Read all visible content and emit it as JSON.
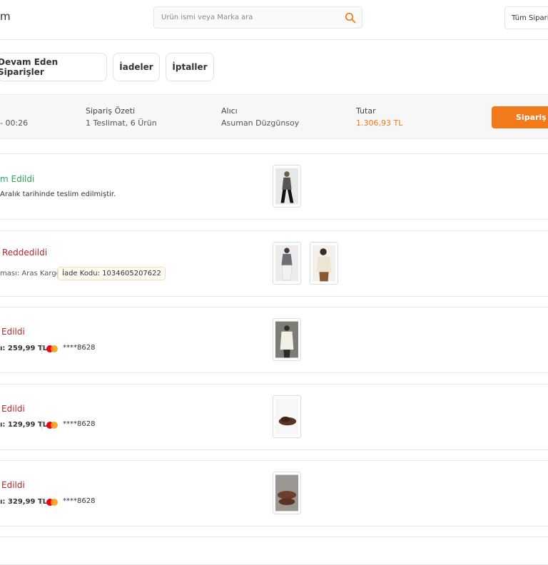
{
  "header": {
    "title": "m",
    "search_placeholder": "Ürün ismi veya Marka ara",
    "filter_label": "Tüm Sipariş"
  },
  "tabs": [
    {
      "label": "Devam Eden Siparişler"
    },
    {
      "label": "İadeler"
    },
    {
      "label": "İptaller"
    }
  ],
  "summary": {
    "time": "- 00:26",
    "summary_label": "Sipariş Özeti",
    "summary_value": "1 Teslimat, 6 Ürün",
    "buyer_label": "Alıcı",
    "buyer_value": "Asuman Düzgünsoy",
    "total_label": "Tutar",
    "total_value": "1.306,93 TL",
    "detail_button": "Sipariş D"
  },
  "colors": {
    "accent": "#f27a1a",
    "green": "#2aa55b",
    "red": "#b3262b"
  },
  "cards": [
    {
      "status": "m Edildi",
      "info": "Aralık tarihinde teslim edilmiştir."
    },
    {
      "status": "Reddedildi",
      "cargo": "ması: Aras Kargo",
      "return_code": "İade Kodu: 1034605207622"
    },
    {
      "status": "Edildi",
      "amount": "ı: 259,99 TL",
      "card": "****8628"
    },
    {
      "status": "Edildi",
      "amount": "ı: 129,99 TL",
      "card": "****8628"
    },
    {
      "status": "Edildi",
      "amount": "ı: 329,99 TL",
      "card": "****8628"
    }
  ]
}
